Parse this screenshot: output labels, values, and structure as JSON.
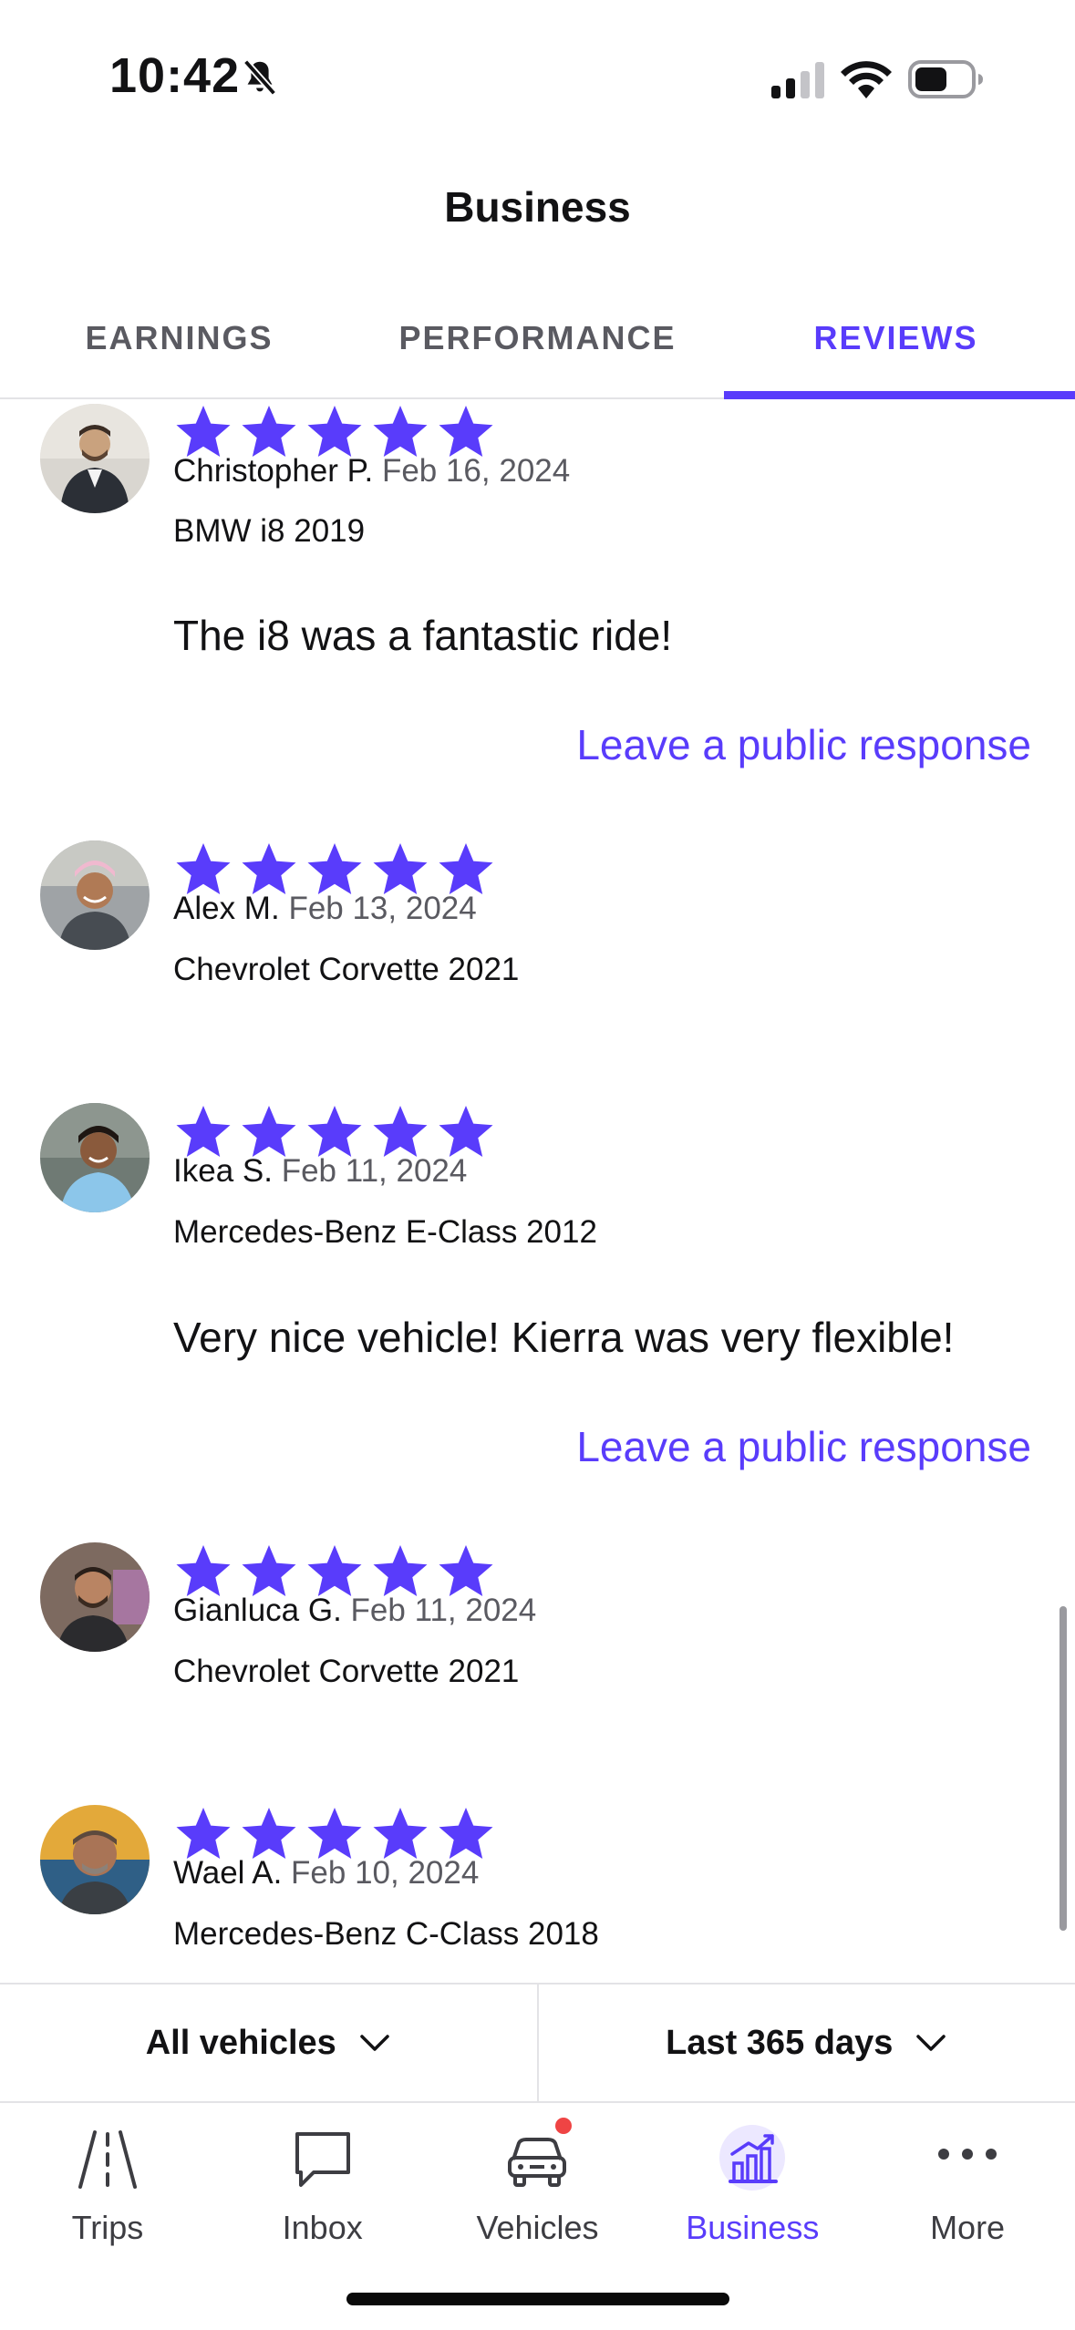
{
  "status_bar": {
    "time": "10:42"
  },
  "header": {
    "title": "Business"
  },
  "tabs": [
    {
      "label": "EARNINGS",
      "active": false
    },
    {
      "label": "PERFORMANCE",
      "active": false
    },
    {
      "label": "REVIEWS",
      "active": true
    }
  ],
  "reviews": [
    {
      "rating": 5,
      "name": "Christopher P.",
      "date": "Feb 16, 2024",
      "vehicle": "BMW i8 2019",
      "comment": "The i8 was a fantastic ride!",
      "response_label": "Leave a public response"
    },
    {
      "rating": 5,
      "name": "Alex M.",
      "date": "Feb 13, 2024",
      "vehicle": "Chevrolet Corvette 2021"
    },
    {
      "rating": 5,
      "name": "Ikea S.",
      "date": "Feb 11, 2024",
      "vehicle": "Mercedes-Benz E-Class 2012",
      "comment": "Very nice vehicle! Kierra was very flexible!",
      "response_label": "Leave a public response"
    },
    {
      "rating": 5,
      "name": "Gianluca G.",
      "date": "Feb 11, 2024",
      "vehicle": "Chevrolet Corvette 2021"
    },
    {
      "rating": 5,
      "name": "Wael A.",
      "date": "Feb 10, 2024",
      "vehicle": "Mercedes-Benz C-Class 2018"
    }
  ],
  "filters": {
    "vehicles": "All vehicles",
    "period": "Last 365 days"
  },
  "bottom_nav": [
    {
      "label": "Trips",
      "icon": "road-icon",
      "active": false
    },
    {
      "label": "Inbox",
      "icon": "chat-bubble-icon",
      "active": false
    },
    {
      "label": "Vehicles",
      "icon": "car-icon",
      "active": false,
      "notification": true
    },
    {
      "label": "Business",
      "icon": "bar-chart-icon",
      "active": true
    },
    {
      "label": "More",
      "icon": "more-dots-icon",
      "active": false
    }
  ],
  "colors": {
    "accent": "#593cfb",
    "star": "#593cfb",
    "text": "#121214",
    "muted": "#5a5a61",
    "notification": "#ef4444"
  }
}
